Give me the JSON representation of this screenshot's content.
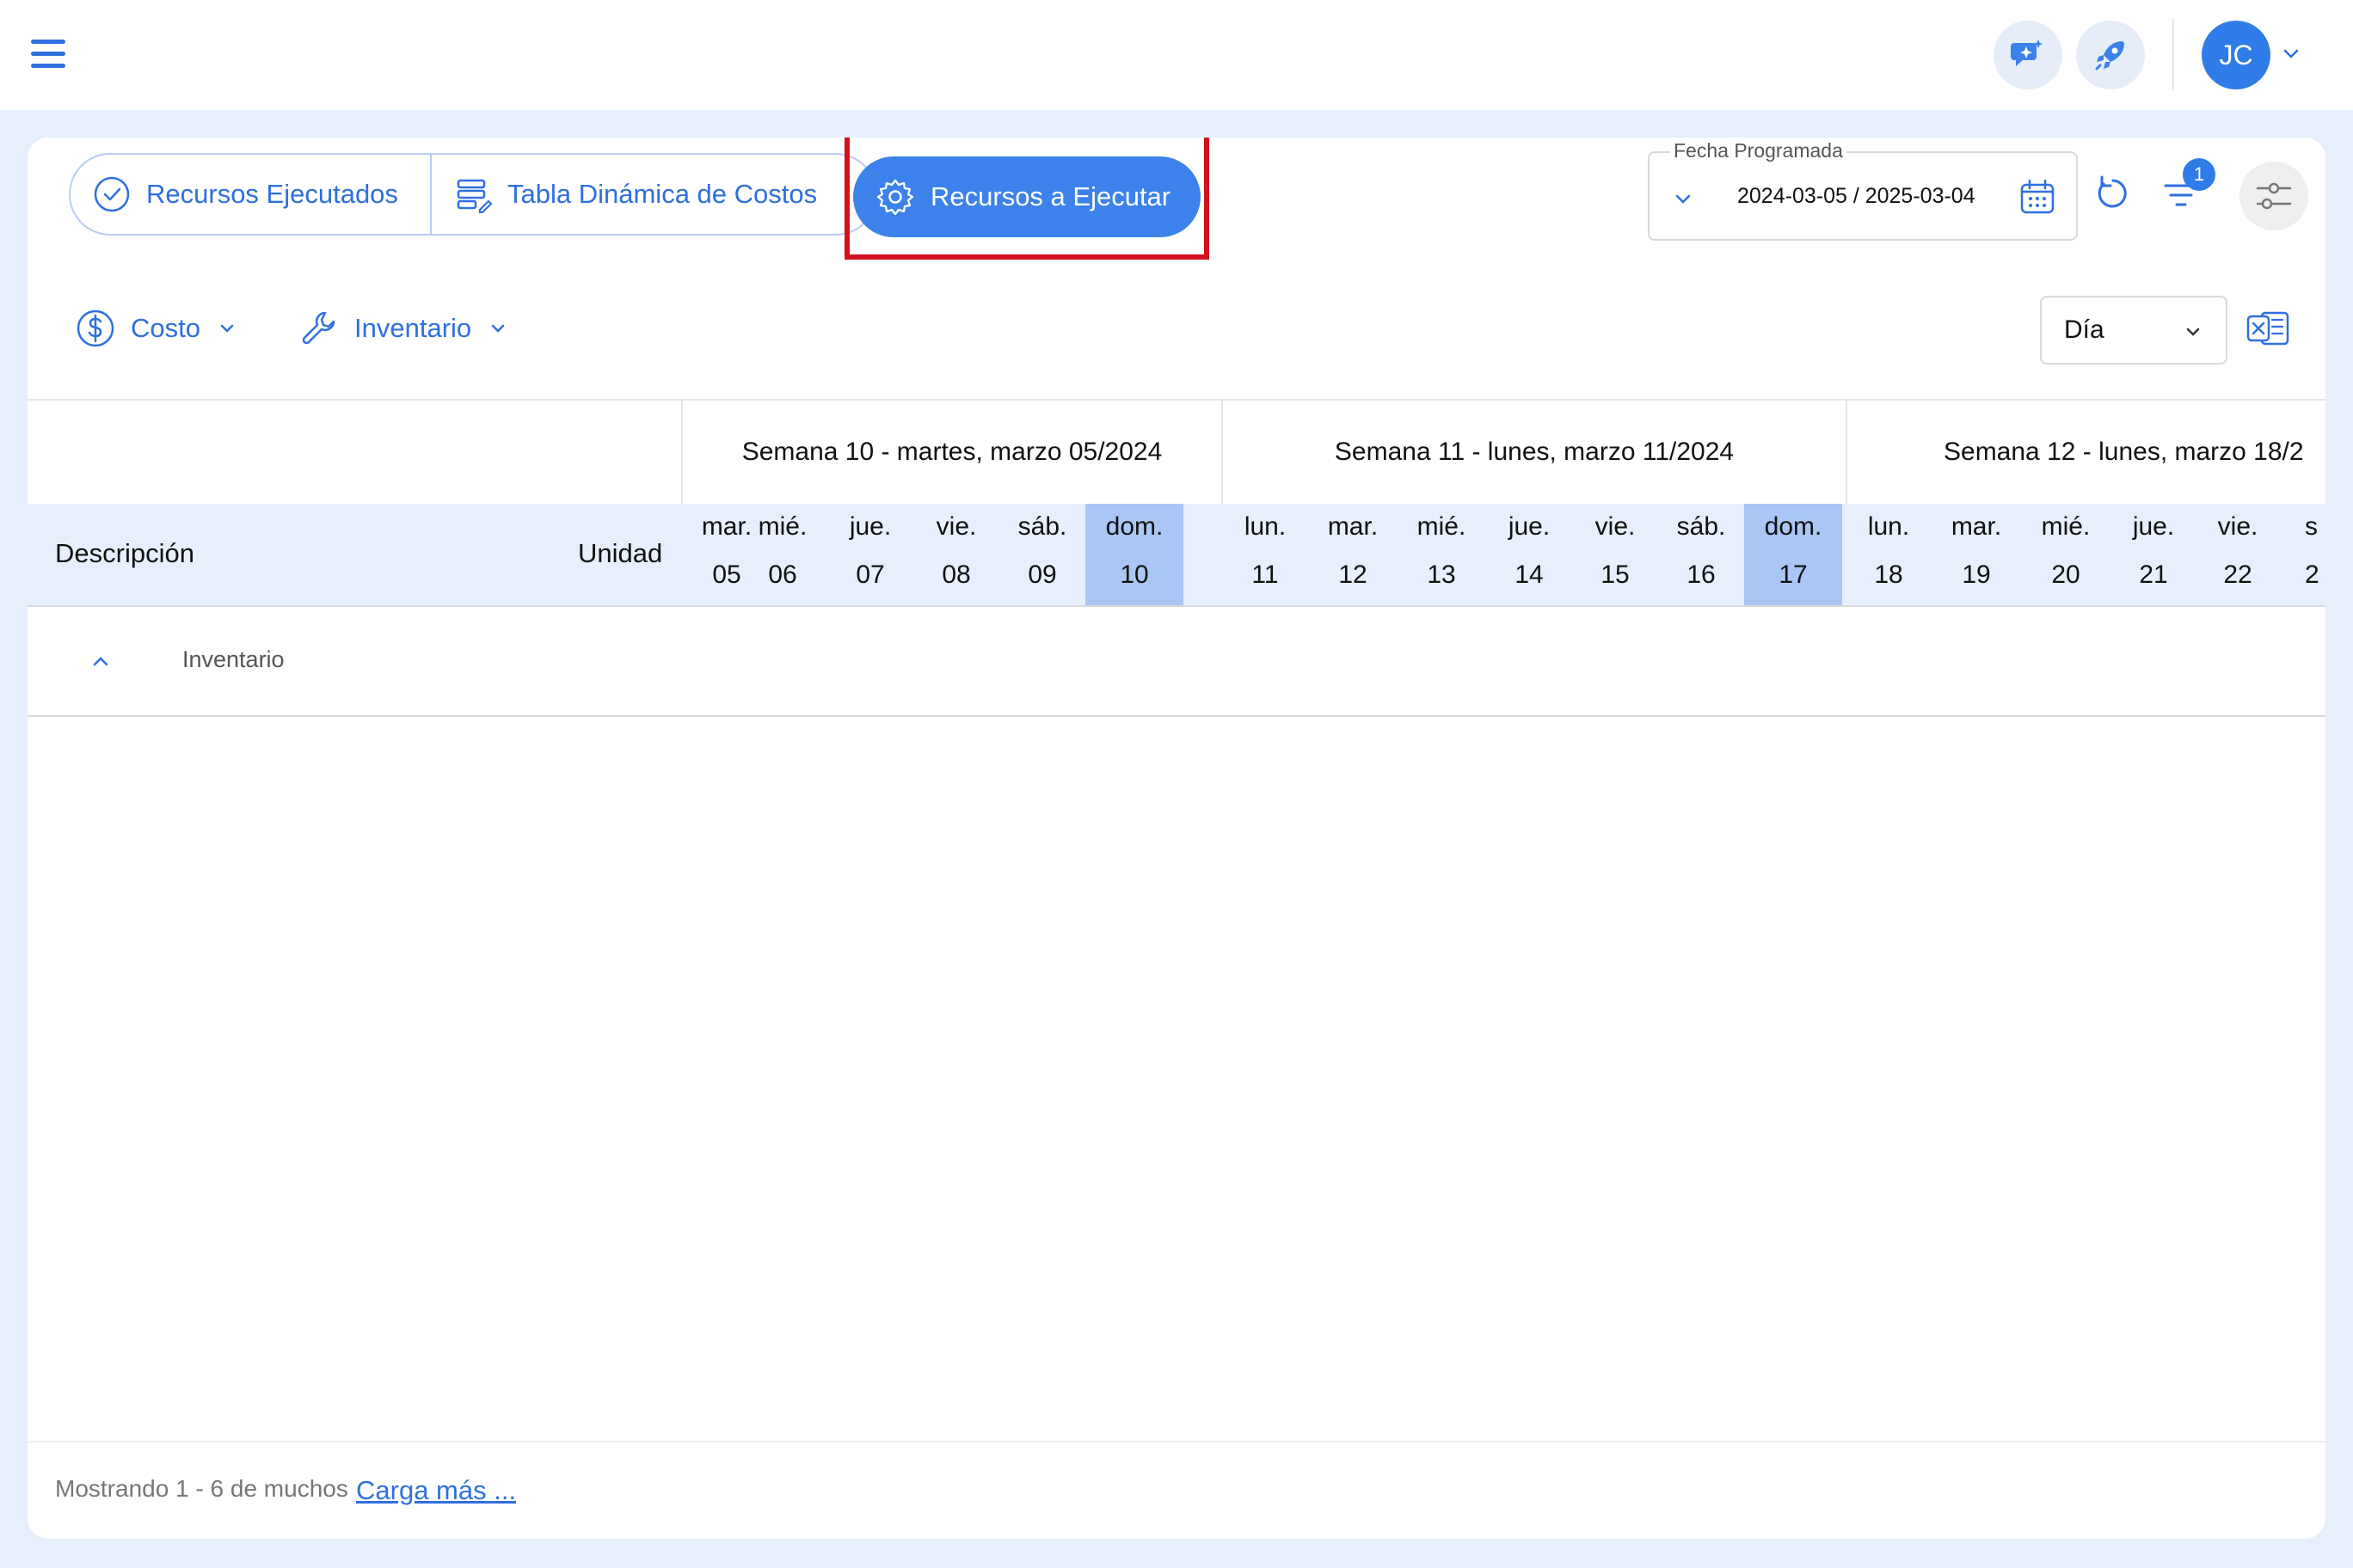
{
  "topbar": {
    "avatar_initials": "JC"
  },
  "tabs": {
    "executed": "Recursos Ejecutados",
    "pivot": "Tabla Dinámica de Costos",
    "to_execute": "Recursos a Ejecutar"
  },
  "date_filter": {
    "label": "Fecha Programada",
    "value": "2024-03-05 / 2025-03-04"
  },
  "filter_badge": "1",
  "toolbar": {
    "cost": "Costo",
    "inventory": "Inventario",
    "period": "Día"
  },
  "grid": {
    "weeks": [
      "Semana 10 - martes, marzo 05/2024",
      "Semana 11 - lunes, marzo 11/2024",
      "Semana 12 - lunes, marzo 18/2"
    ],
    "col_description": "Descripción",
    "col_unit": "Unidad",
    "days": [
      {
        "wd": "mar.",
        "dn": "05"
      },
      {
        "wd": "mié.",
        "dn": "06"
      },
      {
        "wd": "jue.",
        "dn": "07"
      },
      {
        "wd": "vie.",
        "dn": "08"
      },
      {
        "wd": "sáb.",
        "dn": "09"
      },
      {
        "wd": "dom.",
        "dn": "10"
      },
      {
        "wd": "lun.",
        "dn": "11"
      },
      {
        "wd": "mar.",
        "dn": "12"
      },
      {
        "wd": "mié.",
        "dn": "13"
      },
      {
        "wd": "jue.",
        "dn": "14"
      },
      {
        "wd": "vie.",
        "dn": "15"
      },
      {
        "wd": "sáb.",
        "dn": "16"
      },
      {
        "wd": "dom.",
        "dn": "17"
      },
      {
        "wd": "lun.",
        "dn": "18"
      },
      {
        "wd": "mar.",
        "dn": "19"
      },
      {
        "wd": "mié.",
        "dn": "20"
      },
      {
        "wd": "jue.",
        "dn": "21"
      },
      {
        "wd": "vie.",
        "dn": "22"
      },
      {
        "wd": "s",
        "dn": "2"
      }
    ],
    "group_label": "Inventario"
  },
  "footer": {
    "showing": "Mostrando 1 - 6 de muchos",
    "load_more": "Carga más ..."
  },
  "colors": {
    "accent": "#3c82ea",
    "highlight": "#d2101e",
    "sunday": "#a9c6f4",
    "header_bg": "#e7effc"
  }
}
